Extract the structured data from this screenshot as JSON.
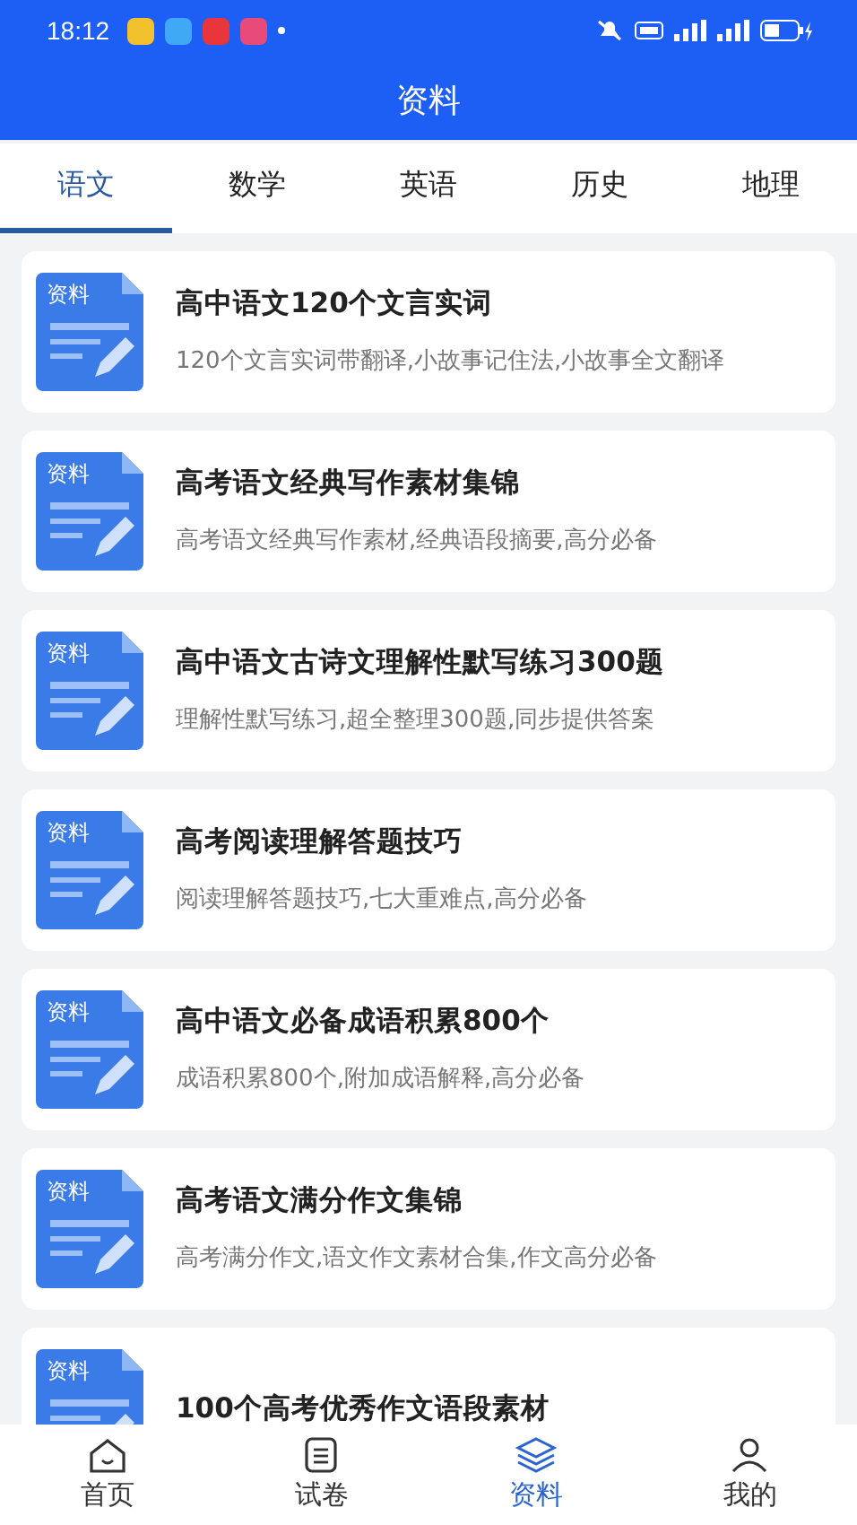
{
  "status_bar": {
    "time": "18:12"
  },
  "header": {
    "title": "资料"
  },
  "tabs": [
    {
      "label": "语文",
      "selected": true
    },
    {
      "label": "数学",
      "selected": false
    },
    {
      "label": "英语",
      "selected": false
    },
    {
      "label": "历史",
      "selected": false
    },
    {
      "label": "地理",
      "selected": false
    }
  ],
  "items": [
    {
      "icon_label": "资料",
      "title": "高中语文120个文言实词",
      "subtitle": "120个文言实词带翻译,小故事记住法,小故事全文翻译"
    },
    {
      "icon_label": "资料",
      "title": "高考语文经典写作素材集锦",
      "subtitle": "高考语文经典写作素材,经典语段摘要,高分必备"
    },
    {
      "icon_label": "资料",
      "title": "高中语文古诗文理解性默写练习300题",
      "subtitle": "理解性默写练习,超全整理300题,同步提供答案"
    },
    {
      "icon_label": "资料",
      "title": "高考阅读理解答题技巧",
      "subtitle": "阅读理解答题技巧,七大重难点,高分必备"
    },
    {
      "icon_label": "资料",
      "title": "高中语文必备成语积累800个",
      "subtitle": "成语积累800个,附加成语解释,高分必备"
    },
    {
      "icon_label": "资料",
      "title": "高考语文满分作文集锦",
      "subtitle": "高考满分作文,语文作文素材合集,作文高分必备"
    },
    {
      "icon_label": "资料",
      "title": "100个高考优秀作文语段素材"
    }
  ],
  "bottom_nav": [
    {
      "label": "首页",
      "selected": false
    },
    {
      "label": "试卷",
      "selected": false
    },
    {
      "label": "资料",
      "selected": true
    },
    {
      "label": "我的",
      "selected": false
    }
  ]
}
